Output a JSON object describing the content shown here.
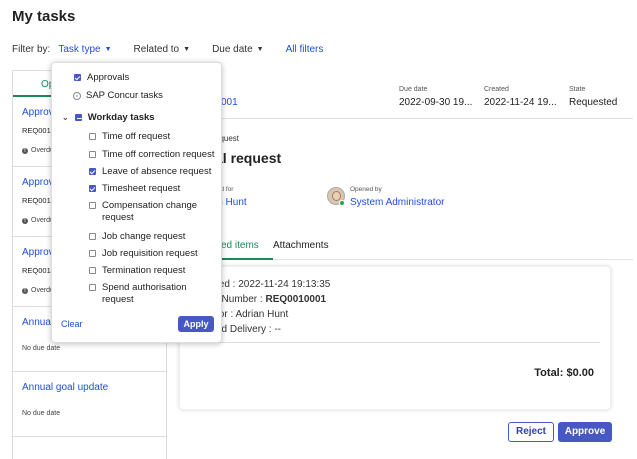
{
  "page": {
    "title": "My tasks"
  },
  "filters": {
    "label": "Filter by:",
    "task_type": "Task type",
    "related_to": "Related to",
    "due_date": "Due date",
    "all_filters": "All filters"
  },
  "left_tab": {
    "label": "Op"
  },
  "tasks": [
    {
      "title": "Approv",
      "number": "REQ0010",
      "due": "Overdu"
    },
    {
      "title": "Approv",
      "number": "REQ0010",
      "due": "Overdu"
    },
    {
      "title": "Approv",
      "number": "REQ0010",
      "due": "Overdu"
    },
    {
      "title": "Annual",
      "due": "No due date"
    },
    {
      "title": "Annual goal update",
      "due": "No due date"
    }
  ],
  "detail": {
    "request_link": "001",
    "due_date_label": "Due date",
    "due_date_value": "2022-09-30 19...",
    "created_label": "Created",
    "created_value": "2022-11-24 19...",
    "state_label": "State",
    "state_value": "Requested",
    "type_small": "equest",
    "title": "al request",
    "created_for_label": "ted for",
    "created_for_value": "in Hunt",
    "opened_by_label": "Opened by",
    "opened_by_value": "System Administrator",
    "tab_requested_items": "ed items",
    "tab_attachments": "Attachments",
    "card": {
      "line1": "ted : 2022-11-24 19:13:35",
      "line2_prefix": "t Number : ",
      "line2_value": "REQ0010001",
      "line3": "tor : Adrian Hunt",
      "line4": "ed Delivery : --",
      "total": "Total: $0.00"
    },
    "reject_label": "Reject",
    "approve_label": "Approve"
  },
  "dropdown": {
    "approvals": "Approvals",
    "sap_concur": "SAP Concur tasks",
    "workday": "Workday tasks",
    "items": [
      {
        "label": "Time off request",
        "checked": false
      },
      {
        "label": "Time off correction request",
        "checked": false
      },
      {
        "label": "Leave of absence request",
        "checked": true
      },
      {
        "label": "Timesheet request",
        "checked": true
      },
      {
        "label": "Compensation change request",
        "checked": false
      },
      {
        "label": "Job change request",
        "checked": false
      },
      {
        "label": "Job requisition request",
        "checked": false
      },
      {
        "label": "Termination request",
        "checked": false
      },
      {
        "label": "Spend authorisation request",
        "checked": false
      }
    ],
    "clear_label": "Clear",
    "apply_label": "Apply"
  },
  "colors": {
    "accent": "#4758c4",
    "link": "#1f4ed8",
    "tab_green": "#1a8a5a"
  }
}
